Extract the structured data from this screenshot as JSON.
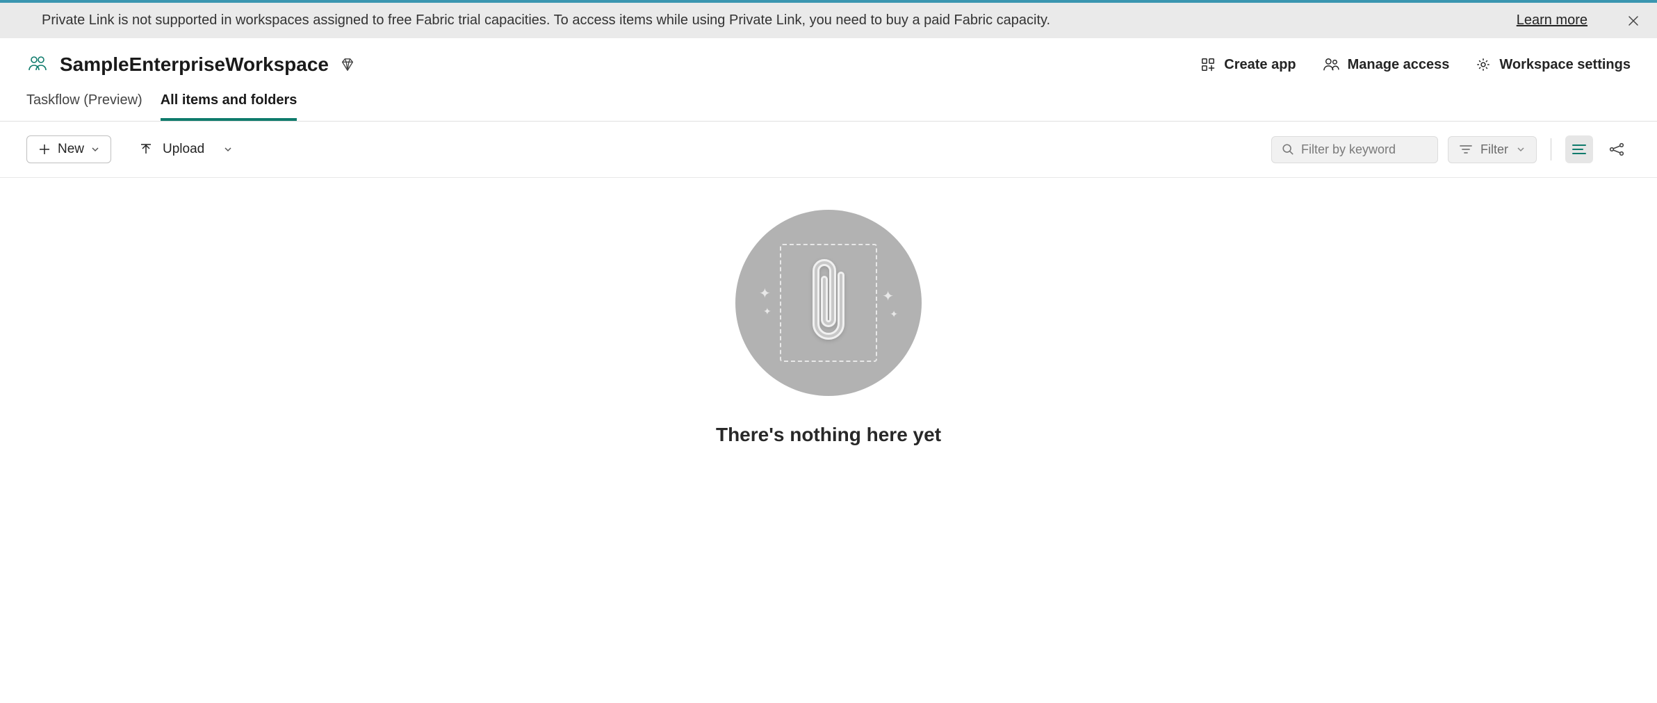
{
  "banner": {
    "text": "Private Link is not supported in workspaces assigned to free Fabric trial capacities. To access items while using Private Link, you need to buy a paid Fabric capacity.",
    "learn_more": "Learn more"
  },
  "header": {
    "workspace_name": "SampleEnterpriseWorkspace",
    "actions": {
      "create_app": "Create app",
      "manage_access": "Manage access",
      "workspace_settings": "Workspace settings"
    }
  },
  "tabs": {
    "taskflow": "Taskflow (Preview)",
    "all_items": "All items and folders"
  },
  "toolbar": {
    "new_label": "New",
    "upload_label": "Upload",
    "filter_placeholder": "Filter by keyword",
    "filter_button": "Filter"
  },
  "empty": {
    "title": "There's nothing here yet"
  }
}
